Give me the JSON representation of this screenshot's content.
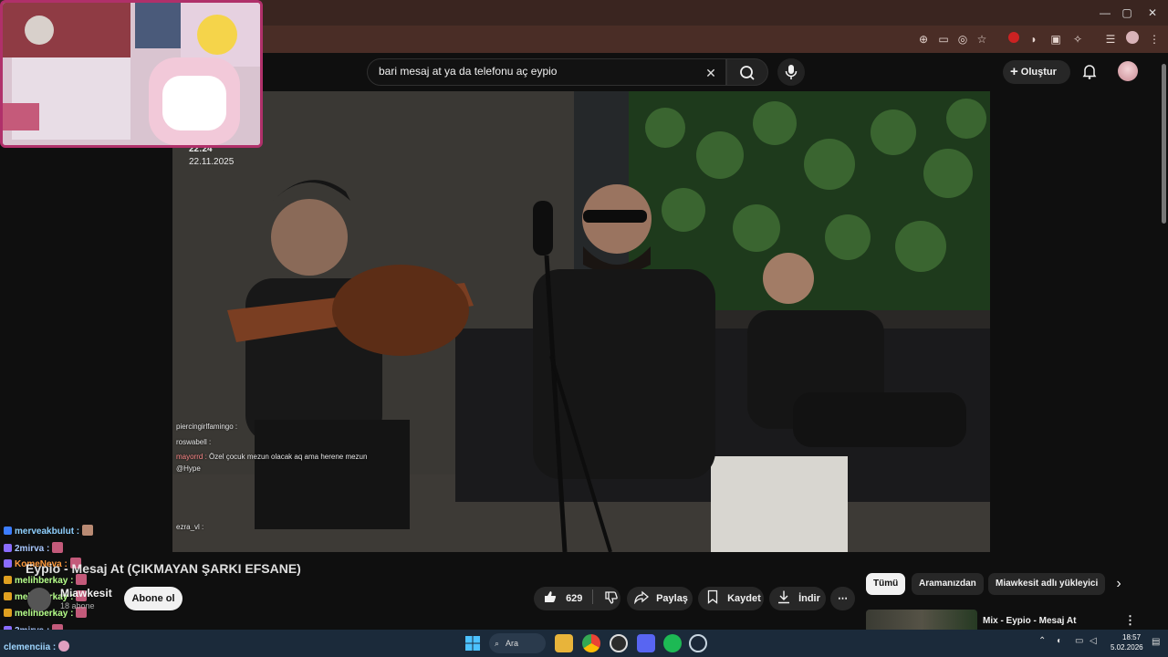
{
  "window": {
    "minimize": "—",
    "maximize": "▢",
    "close": "✕"
  },
  "search": {
    "value": "bari mesaj at ya da telefonu aç eypio"
  },
  "header": {
    "create_label": "Oluştur"
  },
  "video": {
    "timestamp_time": "22:24",
    "timestamp_date": "22.11.2025",
    "title": "Eypio - Mesaj At (ÇIKMAYAN ŞARKI EFSANE)"
  },
  "in_video_chat": [
    {
      "user": "piercingirlfamingo :",
      "text": ""
    },
    {
      "user": "roswabell :",
      "text": ""
    },
    {
      "user": "mayorrd :",
      "text": "Özel çocuk mezun olacak aq ama herene mezun"
    },
    {
      "user": "@Hype",
      "text": ""
    },
    {
      "user": "",
      "text": ""
    },
    {
      "user": "",
      "text": ""
    },
    {
      "user": "",
      "text": ""
    },
    {
      "user": "ezra_vl :",
      "text": ""
    }
  ],
  "channel": {
    "name": "Miawkesit",
    "subscribers": "18 abone",
    "subscribe_label": "Abone ol"
  },
  "actions": {
    "likes": "629",
    "share": "Paylaş",
    "save": "Kaydet",
    "download": "İndir"
  },
  "chips": [
    "Tümü",
    "Aramanızdan",
    "Miawkesit adlı yükleyici"
  ],
  "recommendation": {
    "title": "Mix - Eypio - Mesaj At"
  },
  "stream_chat": [
    {
      "user": "merveakbulut :",
      "color": "#8fd0ff"
    },
    {
      "user": "2mirva :",
      "color": "#a9c8ff"
    },
    {
      "user": "KomeNeva :",
      "color": "#ff9a3c"
    },
    {
      "user": "melihberkay :",
      "color": "#b6ff8a"
    },
    {
      "user": "melihberkay :",
      "color": "#b6ff8a"
    },
    {
      "user": "melihberkay :",
      "color": "#b6ff8a"
    },
    {
      "user": "2mirva :",
      "color": "#a9c8ff"
    },
    {
      "user": "clemenciia :",
      "color": "#9fd6ff"
    }
  ],
  "taskbar": {
    "search_label": "Ara",
    "time": "18:57",
    "date": "5.02.2026"
  }
}
